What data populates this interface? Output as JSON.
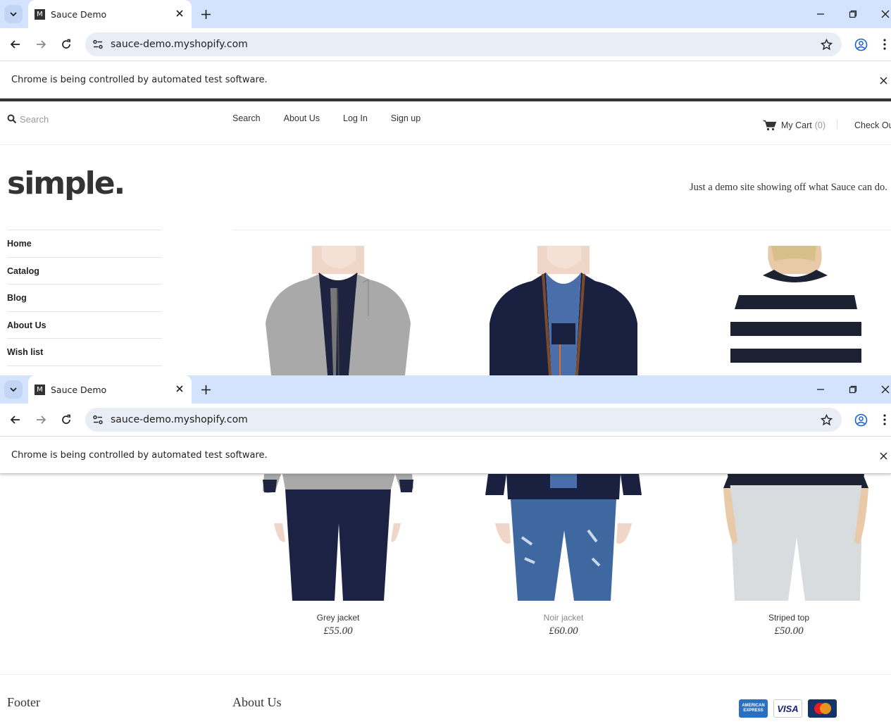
{
  "browser": {
    "tab_title": "Sauce Demo",
    "tab_favicon_letter": "M",
    "url": "sauce-demo.myshopify.com",
    "infobar_text": "Chrome is being controlled by automated test software."
  },
  "header": {
    "search_placeholder": "Search",
    "links": [
      "Search",
      "About Us",
      "Log In",
      "Sign up"
    ],
    "cart_label": "My Cart",
    "cart_count": "(0)",
    "checkout_label": "Check Out"
  },
  "brand": {
    "logo": "simple.",
    "tagline": "Just a demo site showing off what Sauce can do."
  },
  "sidenav": {
    "items": [
      "Home",
      "Catalog",
      "Blog",
      "About Us",
      "Wish list"
    ]
  },
  "products": [
    {
      "name": "Grey jacket",
      "price": "£55.00"
    },
    {
      "name": "Noir jacket",
      "price": "£60.00"
    },
    {
      "name": "Striped top",
      "price": "£50.00"
    }
  ],
  "footer": {
    "col1_title": "Footer",
    "col2_title": "About Us",
    "payment_icons": [
      "american-express-icon",
      "visa-icon",
      "mastercard-icon"
    ],
    "amex_text": "AMERICAN EXPRESS",
    "visa_text": "VISA"
  },
  "colors": {
    "tabstrip": "#d3e3fd",
    "omnibox": "#e9eef6",
    "top_border": "#333333"
  }
}
